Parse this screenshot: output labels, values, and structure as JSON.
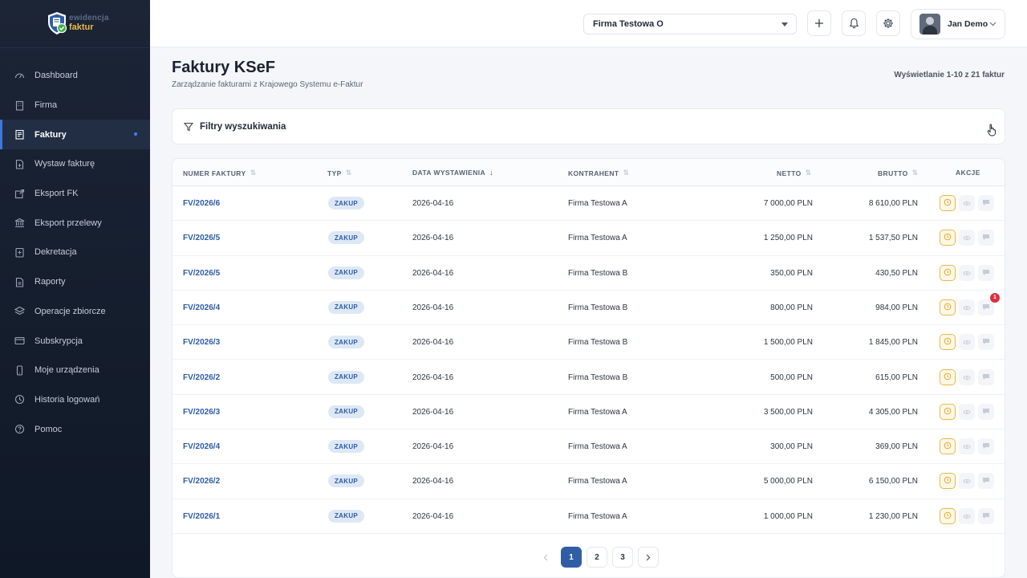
{
  "brand": {
    "line1": "ewidencja",
    "line2": "faktur"
  },
  "sidebar": {
    "items": [
      {
        "label": "Dashboard",
        "icon": "dashboard-icon"
      },
      {
        "label": "Firma",
        "icon": "building-icon"
      },
      {
        "label": "Faktury",
        "icon": "invoice-icon",
        "active": true
      },
      {
        "label": "Wystaw fakturę",
        "icon": "new-document-icon"
      },
      {
        "label": "Eksport FK",
        "icon": "export-icon"
      },
      {
        "label": "Eksport przelewy",
        "icon": "bank-icon"
      },
      {
        "label": "Dekretacja",
        "icon": "ledger-icon"
      },
      {
        "label": "Raporty",
        "icon": "report-icon"
      },
      {
        "label": "Operacje zbiorcze",
        "icon": "layers-icon"
      },
      {
        "label": "Subskrypcja",
        "icon": "credit-card-icon"
      },
      {
        "label": "Moje urządzenia",
        "icon": "phone-icon"
      },
      {
        "label": "Historia logowań",
        "icon": "history-icon"
      },
      {
        "label": "Pomoc",
        "icon": "help-icon"
      }
    ]
  },
  "topbar": {
    "company": "Firma Testowa O",
    "user": "Jan Demo"
  },
  "page": {
    "title": "Faktury KSeF",
    "subtitle": "Zarządzanie fakturami z Krajowego Systemu e-Faktur",
    "count": "Wyświetlanie 1-10 z 21 faktur"
  },
  "filters": {
    "label": "Filtry wyszukiwania"
  },
  "table": {
    "headers": {
      "number": "NUMER FAKTURY",
      "type": "TYP",
      "date": "DATA WYSTAWIENIA",
      "contractor": "KONTRAHENT",
      "net": "NETTO",
      "gross": "BRUTTO",
      "actions": "AKCJE"
    },
    "rows": [
      {
        "number": "FV/2026/6",
        "type": "ZAKUP",
        "date": "2026-04-16",
        "contractor": "Firma Testowa A",
        "net": "7 000,00 PLN",
        "gross": "8 610,00 PLN"
      },
      {
        "number": "FV/2026/5",
        "type": "ZAKUP",
        "date": "2026-04-16",
        "contractor": "Firma Testowa A",
        "net": "1 250,00 PLN",
        "gross": "1 537,50 PLN"
      },
      {
        "number": "FV/2026/5",
        "type": "ZAKUP",
        "date": "2026-04-16",
        "contractor": "Firma Testowa B",
        "net": "350,00 PLN",
        "gross": "430,50 PLN"
      },
      {
        "number": "FV/2026/4",
        "type": "ZAKUP",
        "date": "2026-04-16",
        "contractor": "Firma Testowa B",
        "net": "800,00 PLN",
        "gross": "984,00 PLN",
        "notification": "1"
      },
      {
        "number": "FV/2026/3",
        "type": "ZAKUP",
        "date": "2026-04-16",
        "contractor": "Firma Testowa B",
        "net": "1 500,00 PLN",
        "gross": "1 845,00 PLN"
      },
      {
        "number": "FV/2026/2",
        "type": "ZAKUP",
        "date": "2026-04-16",
        "contractor": "Firma Testowa B",
        "net": "500,00 PLN",
        "gross": "615,00 PLN"
      },
      {
        "number": "FV/2026/3",
        "type": "ZAKUP",
        "date": "2026-04-16",
        "contractor": "Firma Testowa A",
        "net": "3 500,00 PLN",
        "gross": "4 305,00 PLN"
      },
      {
        "number": "FV/2026/4",
        "type": "ZAKUP",
        "date": "2026-04-16",
        "contractor": "Firma Testowa A",
        "net": "300,00 PLN",
        "gross": "369,00 PLN"
      },
      {
        "number": "FV/2026/2",
        "type": "ZAKUP",
        "date": "2026-04-16",
        "contractor": "Firma Testowa A",
        "net": "5 000,00 PLN",
        "gross": "6 150,00 PLN"
      },
      {
        "number": "FV/2026/1",
        "type": "ZAKUP",
        "date": "2026-04-16",
        "contractor": "Firma Testowa A",
        "net": "1 000,00 PLN",
        "gross": "1 230,00 PLN"
      }
    ]
  },
  "pagination": {
    "pages": [
      "1",
      "2",
      "3"
    ],
    "current": "1"
  },
  "colors": {
    "accent": "#2f5ea5",
    "sidebar": "#1c2536",
    "warning": "#e8b84a",
    "danger": "#dc2f3d"
  }
}
